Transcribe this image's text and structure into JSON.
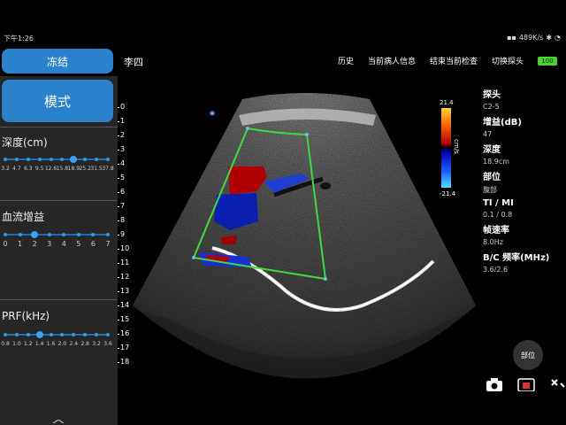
{
  "status_bar": {
    "time": "下午1:26",
    "network_speed": "489K/s"
  },
  "header": {
    "freeze_label": "冻结",
    "patient_name": "李四",
    "nav": [
      "历史",
      "当前病人信息",
      "结束当前检查",
      "切换探头"
    ],
    "battery_label": "100"
  },
  "left_panel": {
    "mode_label": "模式",
    "depth": {
      "label": "深度(cm)",
      "ticks": [
        "3.2",
        "4.7",
        "6.3",
        "9.5",
        "12.6",
        "15.8",
        "18.9",
        "25.2",
        "31.5",
        "37.8"
      ],
      "selected_index": 6
    },
    "flow_gain": {
      "label": "血流增益",
      "ticks": [
        "0",
        "1",
        "2",
        "3",
        "4",
        "5",
        "6",
        "7"
      ],
      "selected_index": 2
    },
    "prf": {
      "label": "PRF(kHz)",
      "ticks": [
        "0.8",
        "1.0",
        "1.2",
        "1.4",
        "1.6",
        "2.0",
        "2.4",
        "2.8",
        "3.2",
        "3.6"
      ],
      "selected_index": 3
    }
  },
  "depth_scale": [
    "0",
    "1",
    "2",
    "3",
    "4",
    "5",
    "6",
    "7",
    "8",
    "9",
    "10",
    "11",
    "12",
    "13",
    "14",
    "15",
    "16",
    "17",
    "18"
  ],
  "color_scale": {
    "max": "21.4",
    "min": "-21.4",
    "unit": "cm/s"
  },
  "info": [
    {
      "label": "探头",
      "value": "C2-5"
    },
    {
      "label": "增益(dB)",
      "value": "47"
    },
    {
      "label": "深度",
      "value": "18.9cm"
    },
    {
      "label": "部位",
      "value": "腹部"
    },
    {
      "label": "TI / MI",
      "value": "0.1 / 0.8"
    },
    {
      "label": "帧速率",
      "value": "8.0Hz"
    },
    {
      "label": "B/C 频率(MHz)",
      "value": "3.6/2.6"
    }
  ],
  "site_button_label": "部位",
  "colors": {
    "accent": "#2b82cc",
    "roi": "#3ddc3d",
    "panel_bg": "#262626"
  }
}
